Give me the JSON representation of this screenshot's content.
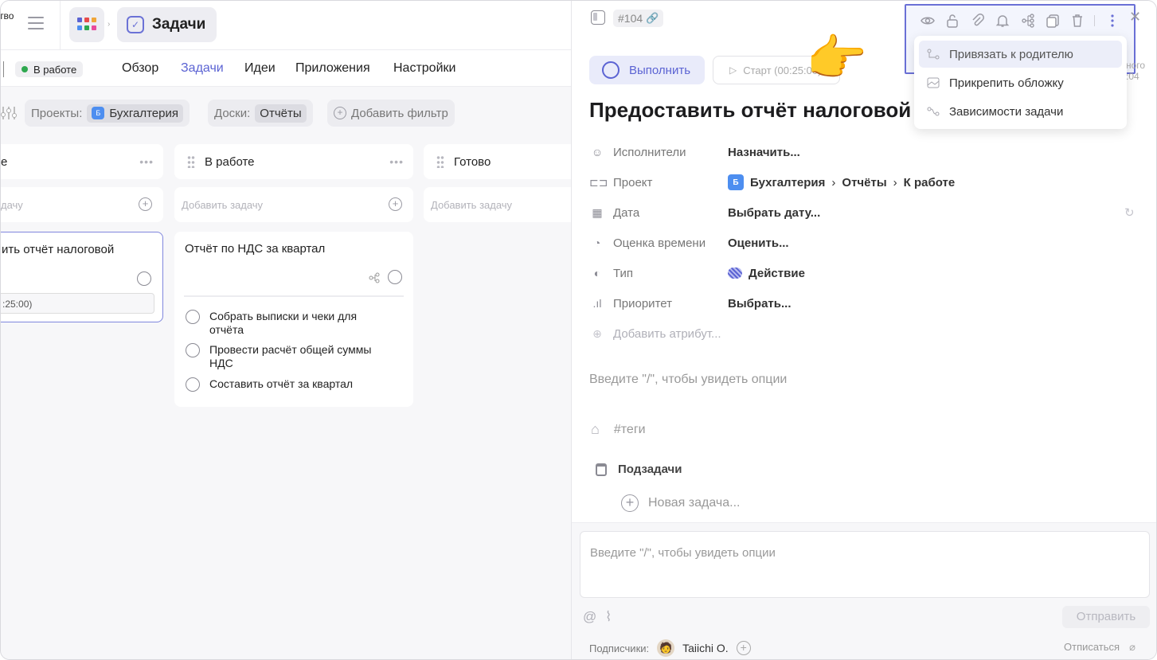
{
  "workspace_label": "тво",
  "header": {
    "app_title": "Задачи"
  },
  "nav": {
    "status": "В работе",
    "tabs": [
      {
        "label": "Обзор"
      },
      {
        "label": "Задачи"
      },
      {
        "label": "Идеи"
      },
      {
        "label": "Приложения"
      },
      {
        "label": "Настройки"
      }
    ]
  },
  "filters": {
    "projects_label": "Проекты:",
    "projects_value": "Бухгалтерия",
    "project_badge": "Б",
    "boards_label": "Доски:",
    "boards_value": "Отчёты",
    "add_filter": "Добавить фильтр"
  },
  "board": {
    "columns": [
      {
        "title": "е",
        "add_placeholder": "дачу"
      },
      {
        "title": "В работе",
        "add_placeholder": "Добавить задачу"
      },
      {
        "title": "Готово",
        "add_placeholder": "Добавить задачу"
      }
    ],
    "card1": {
      "title": "ить отчёт налоговой",
      "timer": ":25:00)"
    },
    "card2": {
      "title": "Отчёт по НДС за квартал",
      "subtasks": [
        "Собрать выписки и чеки для отчёта",
        "Провести расчёт общей суммы НДС",
        "Составить отчёт за квартал"
      ]
    }
  },
  "panel": {
    "task_id": "#104",
    "menu": [
      {
        "label": "Привязать к родителю"
      },
      {
        "label": "Прикрепить обложку"
      },
      {
        "label": "Зависимости задачи"
      }
    ],
    "exec_button": "Выполнить",
    "start_button": "Старт (00:25:00)",
    "edge_text_1": "ного",
    "edge_text_2": ":04",
    "title": "Предоставить отчёт налоговой",
    "attributes": {
      "assignees_label": "Исполнители",
      "assignees_value": "Назначить...",
      "project_label": "Проект",
      "project_badge": "Б",
      "project_name": "Бухгалтерия",
      "project_board": "Отчёты",
      "project_column": "К работе",
      "date_label": "Дата",
      "date_value": "Выбрать дату...",
      "estimate_label": "Оценка времени",
      "estimate_value": "Оценить...",
      "type_label": "Тип",
      "type_value": "Действие",
      "priority_label": "Приоритет",
      "priority_value": "Выбрать...",
      "add_attribute": "Добавить атрибут..."
    },
    "description_placeholder": "Введите \"/\", чтобы увидеть опции",
    "tags_placeholder": "#теги",
    "subtasks_label": "Подзадачи",
    "new_task": "Новая задача...",
    "comment_placeholder": "Введите \"/\", чтобы увидеть опции",
    "send_button": "Отправить",
    "subscribers_label": "Подписчики:",
    "subscriber_name": "Taiichi O.",
    "unsubscribe": "Отписаться"
  },
  "colors": {
    "accent": "#5b63d3",
    "highlight_border": "#6a70d6",
    "status_green": "#2fa84f",
    "project_blue": "#4d8ef0"
  }
}
